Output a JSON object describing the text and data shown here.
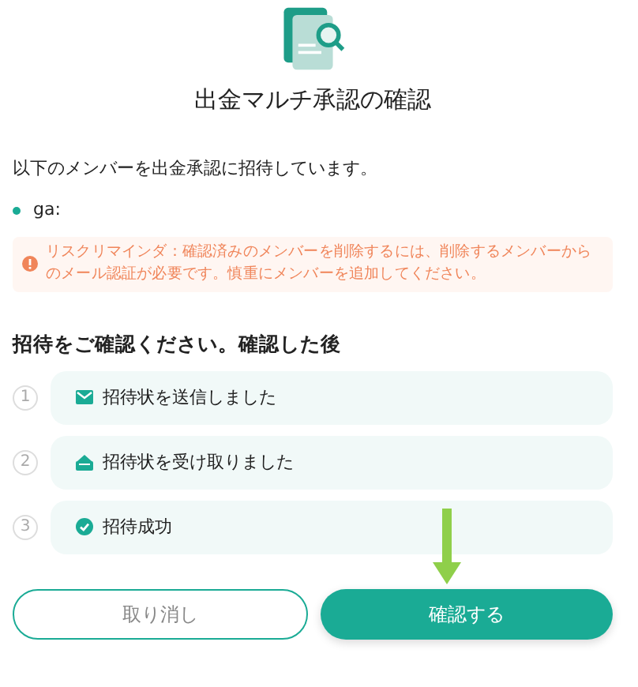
{
  "title": "出金マルチ承認の確認",
  "intro": "以下のメンバーを出金承認に招待しています。",
  "members": [
    "ga:"
  ],
  "warning": "リスクリマインダ：確認済みのメンバーを削除するには、削除するメンバーからのメール認証が必要です。慎重にメンバーを追加してください。",
  "steps_heading": "招待をご確認ください。確認した後",
  "steps": [
    {
      "number": "1",
      "kind": "sent",
      "label": "招待状を送信しました"
    },
    {
      "number": "2",
      "kind": "received",
      "label": "招待状を受け取りました"
    },
    {
      "number": "3",
      "kind": "success",
      "label": "招待成功"
    }
  ],
  "buttons": [
    {
      "kind": "secondary",
      "label": "取り消し"
    },
    {
      "kind": "primary",
      "label": "確認する"
    }
  ]
}
